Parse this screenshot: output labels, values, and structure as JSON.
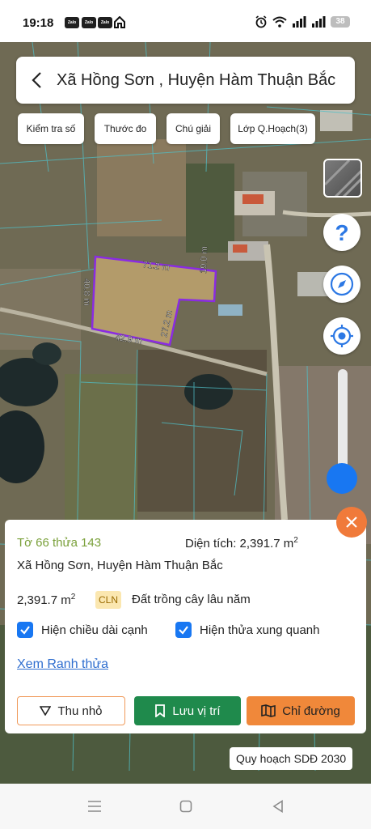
{
  "status": {
    "time": "19:18",
    "notif_icons": [
      "zalo-icon",
      "zalo-icon",
      "zalo-icon",
      "home-icon"
    ],
    "battery": "38"
  },
  "header": {
    "title": "Xã Hồng Sơn , Huyện Hàm Thuận Bắc"
  },
  "chips": [
    "Kiểm tra số",
    "Thước đo",
    "Chú giải",
    "Lớp Q.Hoạch(3)"
  ],
  "map": {
    "dimensions": [
      "71.2 m",
      "40.8 m",
      "19.0 m",
      "27.2 m",
      "42.9 m"
    ],
    "parcel_color": "#8a2be2"
  },
  "controls": {
    "help_icon": "question-icon",
    "compass_icon": "compass-icon",
    "locate_icon": "locate-icon",
    "opacity_level": 0.85
  },
  "panel": {
    "parcel": "Tờ 66 thửa 143",
    "area_label": "Diện tích: 2,391.7 m",
    "area_sup": "2",
    "address": "Xã Hồng Sơn, Huyện Hàm Thuận Bắc",
    "area_value": "2,391.7 m",
    "area_value_sup": "2",
    "land_code": "CLN",
    "land_type": "Đất trồng cây lâu năm",
    "check_edges": "Hiện chiều dài cạnh",
    "check_neighbors": "Hiện thửa xung quanh",
    "link": "Xem Ranh thửa",
    "btn_shrink": "Thu nhỏ",
    "btn_save": "Lưu vị trí",
    "btn_route": "Chỉ đường"
  },
  "plan_tag": "Quy hoạch SDĐ 2030",
  "colors": {
    "accent_blue": "#1877f2",
    "green": "#1f8a4c",
    "orange": "#f0883a",
    "parcel_id_green": "#7aa03a"
  }
}
